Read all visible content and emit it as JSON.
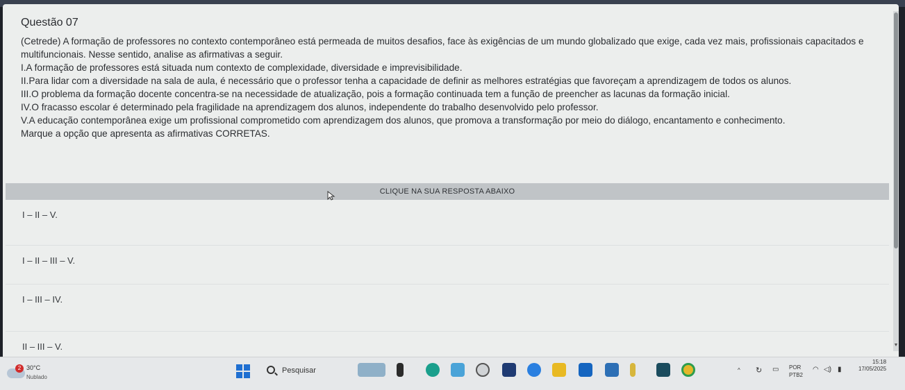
{
  "question": {
    "title": "Questão 07",
    "stem_lines": [
      "(Cetrede) A formação de professores no contexto contemporâneo está permeada de muitos desafios, face às exigências de um mundo globalizado que exige, cada vez mais, profissionais capacitados e",
      "multifuncionais. Nesse sentido, analise as afirmativas a seguir.",
      "I.A formação de professores está situada num contexto de complexidade, diversidade e imprevisibilidade.",
      "II.Para lidar com a diversidade na sala de aula, é necessário que o professor tenha a capacidade de definir as melhores estratégias que favoreçam a aprendizagem de todos os alunos.",
      "III.O problema da formação docente concentra-se na necessidade de atualização, pois a formação continuada tem a função de preencher as lacunas da formação inicial.",
      "IV.O fracasso escolar é determinado pela fragilidade na aprendizagem dos alunos, independente do trabalho desenvolvido pelo professor.",
      "V.A educação contemporânea exige um profissional comprometido com aprendizagem dos alunos, que promova a transformação por meio do diálogo, encantamento e conhecimento.",
      "Marque a opção que apresenta as afirmativas CORRETAS."
    ]
  },
  "answer_banner": "CLIQUE NA SUA RESPOSTA ABAIXO",
  "options": [
    {
      "label": "I – II – V."
    },
    {
      "label": "I – II – III – V."
    },
    {
      "label": "I – III – IV."
    },
    {
      "label": "II – III – V."
    }
  ],
  "taskbar": {
    "weather": {
      "badge": "2",
      "temp": "30°C",
      "condition": "Nublado"
    },
    "search_label": "Pesquisar",
    "tray": {
      "lang": "POR",
      "layout": "PTB2",
      "time": "15:18",
      "date": "17/05/2025"
    }
  },
  "colors": {
    "page_bg": "#eceeed",
    "banner_bg": "#c0c4c7",
    "taskbar_bg": "#e6e8ea",
    "accent": "#1f6fd1"
  }
}
